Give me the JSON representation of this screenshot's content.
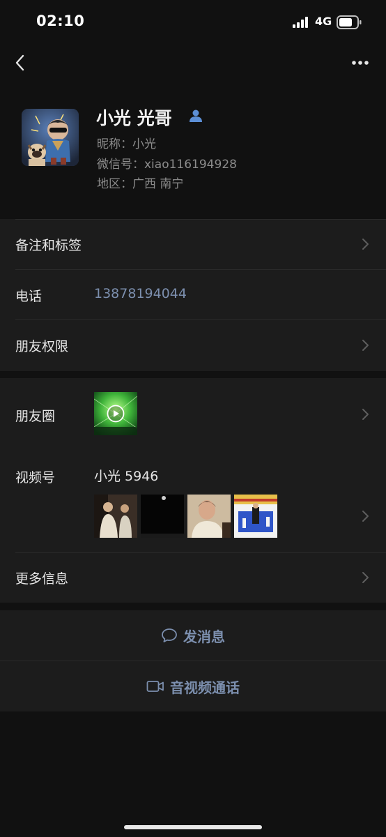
{
  "status_bar": {
    "time": "02:10",
    "network": "4G",
    "icons": [
      "signal-icon",
      "battery-icon"
    ]
  },
  "nav": {
    "back_icon": "chevron-left-icon",
    "more_icon": "ellipsis-icon"
  },
  "profile": {
    "name": "小光 光哥",
    "nickname": "昵称：小光",
    "wechat_id": "微信号：xiao116194928",
    "region": "地区：广西 南宁",
    "name_badge_icon": "person-icon"
  },
  "rows": {
    "remark_tags": "备注和标签",
    "phone_label": "电话",
    "phone_value": "13878194044",
    "friend_permissions": "朋友权限",
    "moments": "朋友圈",
    "channels_label": "视频号",
    "channels_value": "小光 5946",
    "more_info": "更多信息"
  },
  "actions": {
    "send_message": "发消息",
    "av_call": "音视频通话"
  },
  "colors": {
    "background": "#111111",
    "section": "#1c1c1c",
    "link_blue": "#7c8fae",
    "badge_blue": "#5c8fd6"
  }
}
